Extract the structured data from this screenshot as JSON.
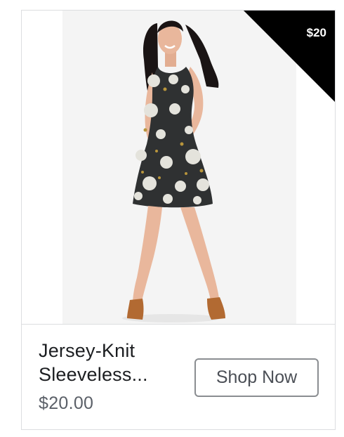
{
  "product": {
    "image_alt": "Woman wearing a dark floral sleeveless dress and tan mules",
    "ribbon_price": "$20",
    "title_line1": "Jersey-Knit",
    "title_line2": "Sleeveless...",
    "price": "$20.00",
    "cta_label": "Shop Now"
  },
  "colors": {
    "ribbon": "#000000",
    "dress": "#2f3132",
    "flowers": "#e4e3dc",
    "shoes": "#b26a32",
    "skin": "#e9b79c",
    "hair": "#1a1414",
    "border": "#dcdde0",
    "title_text": "#1c1e21",
    "price_text": "#5b6068"
  }
}
